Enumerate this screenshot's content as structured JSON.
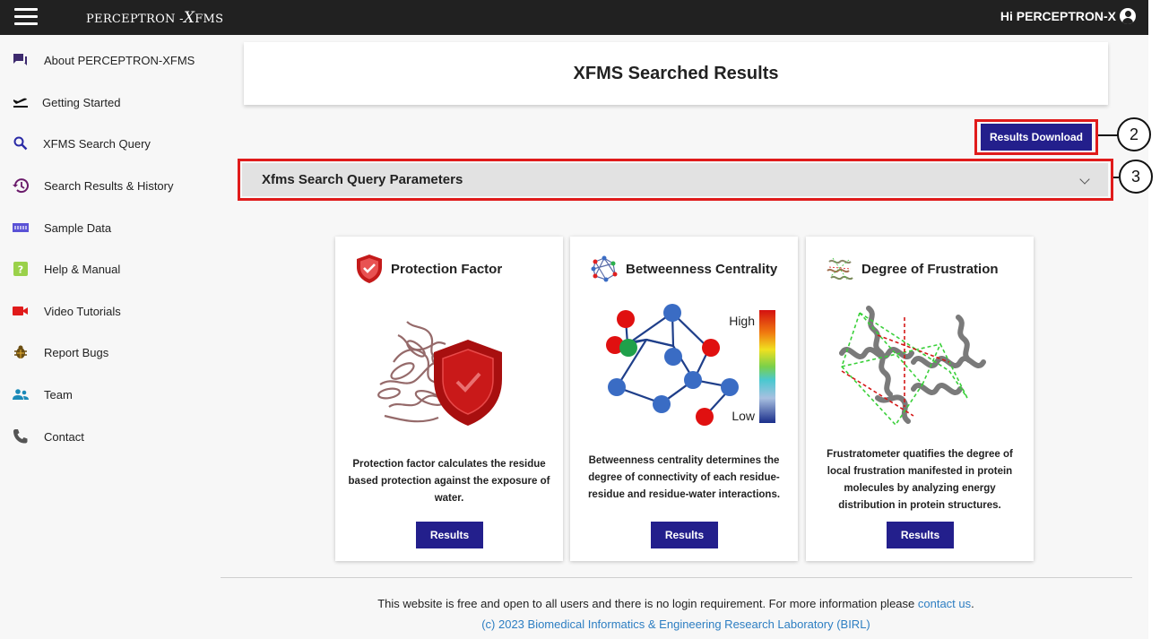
{
  "header": {
    "brand_main": "PERCEPTRON -",
    "brand_x": "X",
    "brand_suffix": "FMS",
    "greeting": "Hi PERCEPTRON-X"
  },
  "sidebar": {
    "items": [
      {
        "label": "About PERCEPTRON-XFMS",
        "icon": "chat-icon"
      },
      {
        "label": "Getting Started",
        "icon": "takeoff-icon"
      },
      {
        "label": "XFMS Search Query",
        "icon": "search-icon"
      },
      {
        "label": "Search Results & History",
        "icon": "history-icon"
      },
      {
        "label": "Sample Data",
        "icon": "data-icon"
      },
      {
        "label": "Help & Manual",
        "icon": "help-icon"
      },
      {
        "label": "Video Tutorials",
        "icon": "video-icon"
      },
      {
        "label": "Report Bugs",
        "icon": "bug-icon"
      },
      {
        "label": "Team",
        "icon": "team-icon"
      },
      {
        "label": "Contact",
        "icon": "phone-icon"
      }
    ]
  },
  "main": {
    "title": "XFMS Searched Results",
    "download_label": "Results Download",
    "accordion_label": "Xfms Search Query Parameters",
    "callouts": [
      "2",
      "3"
    ],
    "cards": [
      {
        "title": "Protection Factor",
        "description": "Protection factor calculates the residue based protection against the exposure of water.",
        "button": "Results"
      },
      {
        "title": "Betweenness Centrality",
        "description": "Betweenness centrality determines the degree of connectivity of each residue-residue and residue-water interactions.",
        "button": "Results",
        "scale_high": "High",
        "scale_low": "Low"
      },
      {
        "title": "Degree of Frustration",
        "description": "Frustratometer quatifies the degree of local frustration manifested in protein molecules by analyzing energy distribution in protein structures.",
        "button": "Results"
      }
    ]
  },
  "footer": {
    "text": "This website is free and open to all users and there is no login requirement. For more information please ",
    "link": "contact us",
    "period": ".",
    "copyright": "(c) 2023 Biomedical Informatics & Engineering Research Laboratory (BIRL)"
  },
  "colors": {
    "topbar": "#212121",
    "button": "#231f8c",
    "highlight": "#e01b1b",
    "link": "#2d7ec2"
  }
}
